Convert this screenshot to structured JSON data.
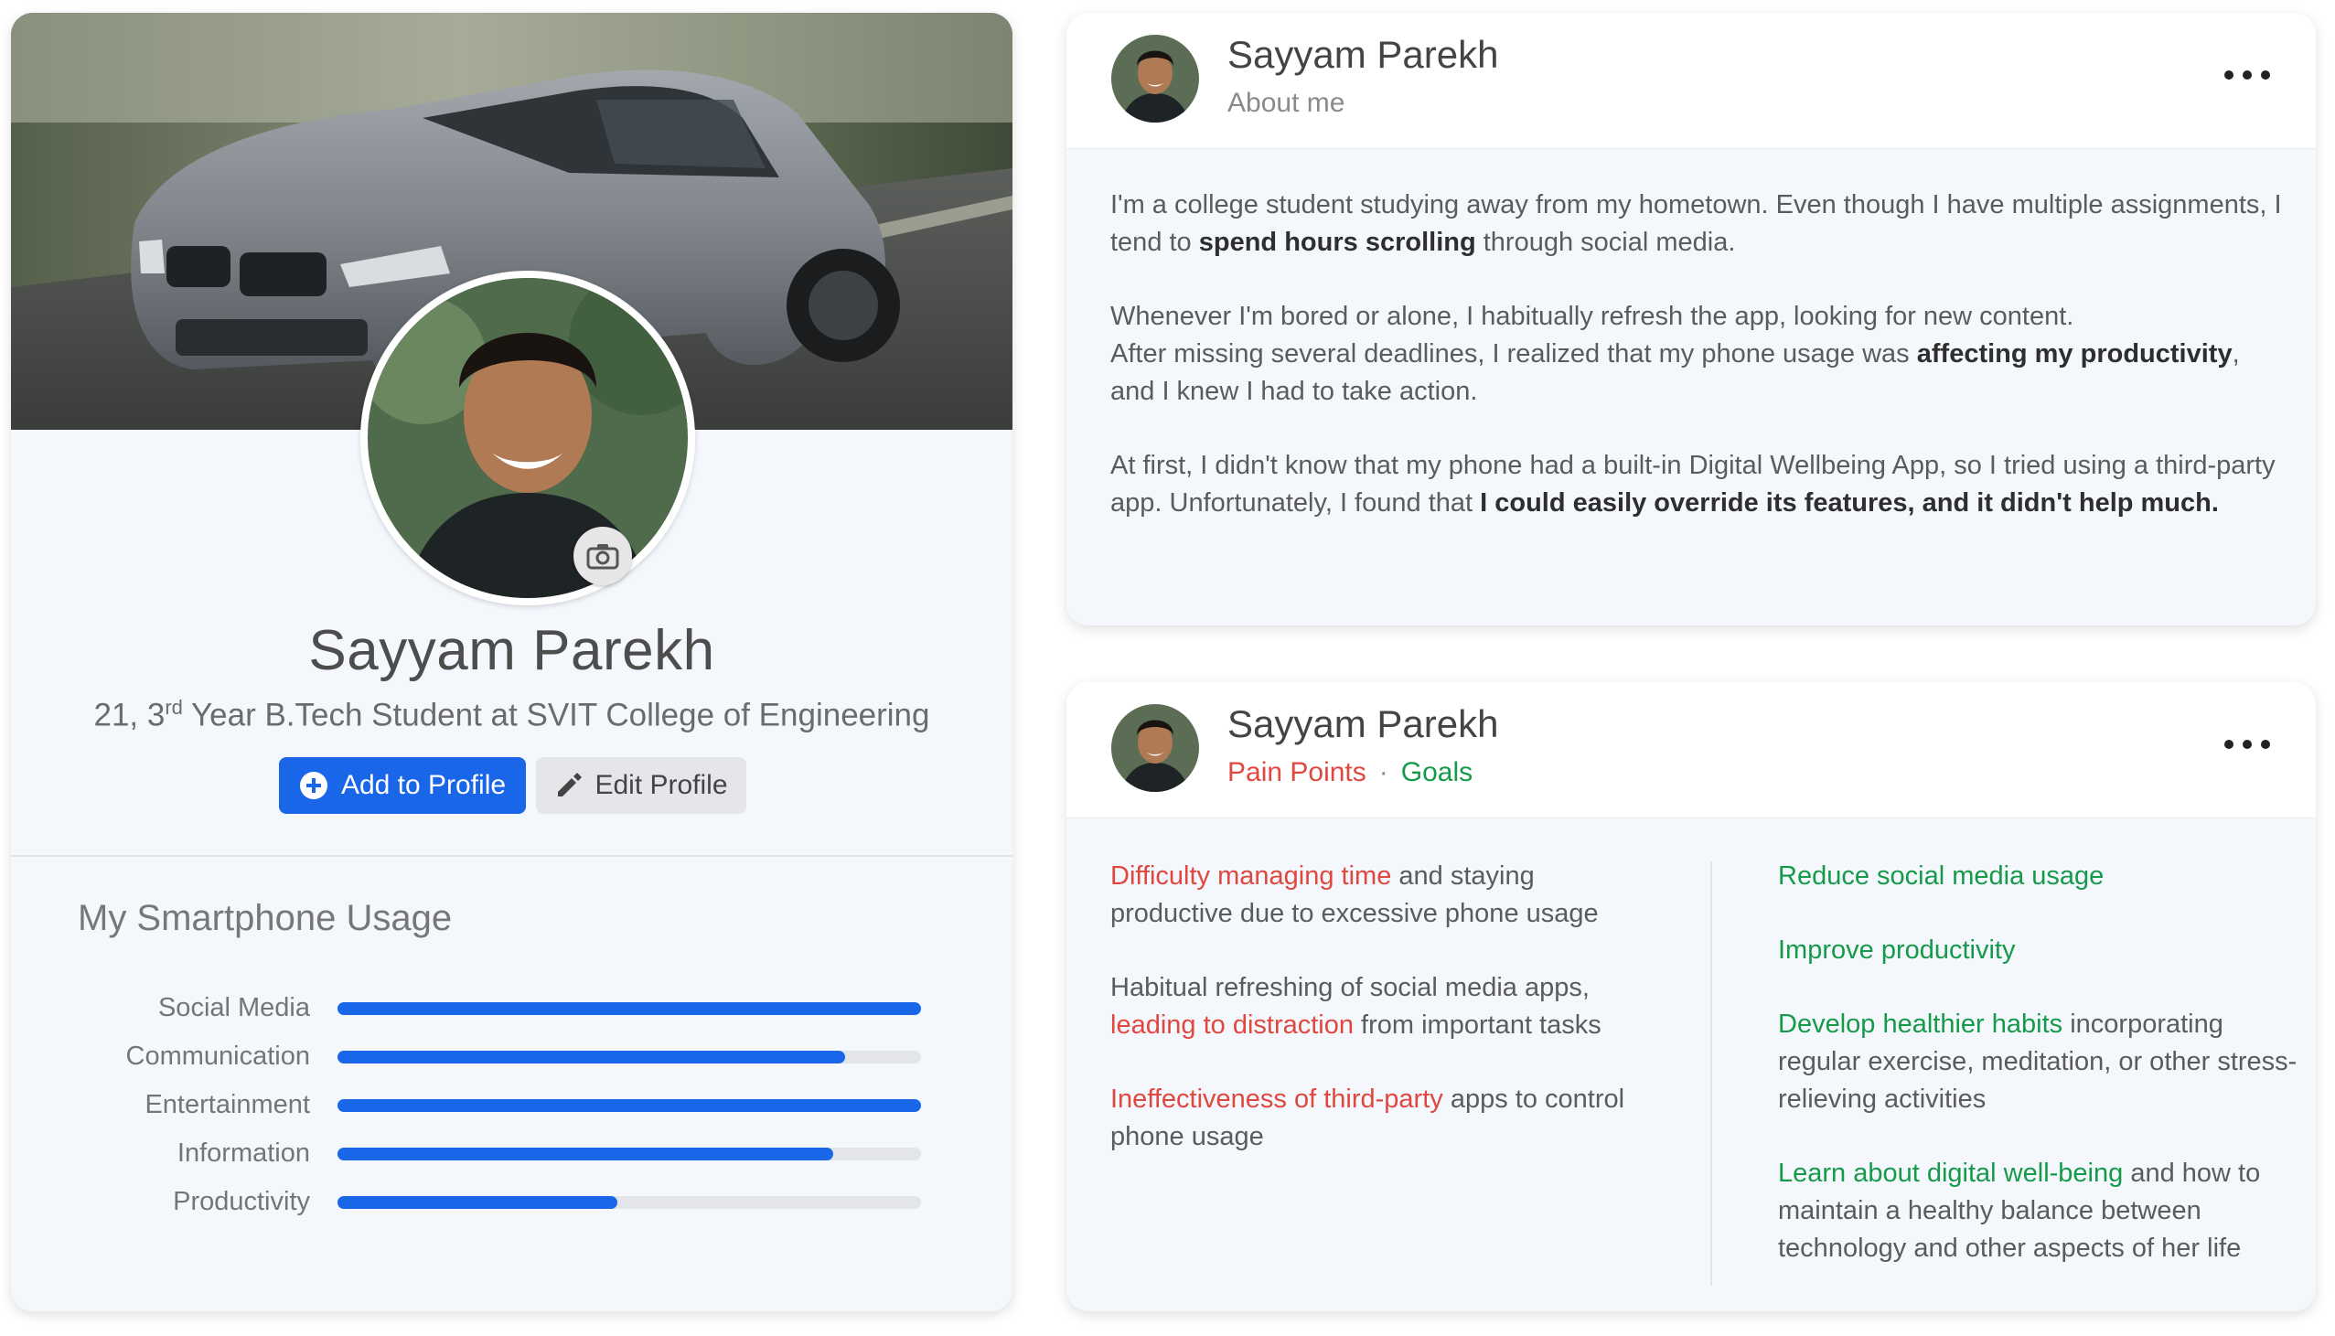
{
  "profile": {
    "name": "Sayyam Parekh",
    "age": "21, 3",
    "ordinal_suffix": "rd",
    "subtitle_rest": " Year B.Tech Student at SVIT College of Engineering",
    "add_button_label": "Add to Profile",
    "edit_button_label": "Edit Profile",
    "cover_image": "grey-sedan-car-photo",
    "camera_icon": "camera-icon"
  },
  "usage": {
    "title": "My Smartphone Usage",
    "accent_color": "#1a66e8",
    "items": [
      {
        "label": "Social Media",
        "value": 1.0
      },
      {
        "label": "Communication",
        "value": 0.87
      },
      {
        "label": "Entertainment",
        "value": 1.0
      },
      {
        "label": "Information",
        "value": 0.85
      },
      {
        "label": "Productivity",
        "value": 0.48
      }
    ]
  },
  "about_card": {
    "name": "Sayyam Parekh",
    "subtitle": "About me",
    "more_icon": "more-horizontal-icon",
    "p1_a": "I'm a college student studying away from my hometown. Even though I have multiple assignments, I tend to ",
    "p1_b": "spend hours scrolling",
    "p1_c": " through social media.",
    "p2_a": "Whenever I'm bored or alone, I habitually refresh the app, looking for new content.",
    "p2_b": "After missing several deadlines, I realized that my phone usage was ",
    "p2_c": "affecting my productivity",
    "p2_d": ", and I knew I had to take action.",
    "p3_a": "At first, I didn't know that my phone had a built-in Digital Wellbeing App, so I tried using a third-party app. Unfortunately, I found that ",
    "p3_b": "I could easily override its features, and it didn't help much."
  },
  "goals_card": {
    "name": "Sayyam Parekh",
    "pain_label": "Pain Points",
    "separator": "·",
    "goals_label": "Goals",
    "pain_color": "#e0473f",
    "goal_color": "#159a4a",
    "pain1_a": "Difficulty managing time",
    "pain1_b": " and staying productive due to excessive phone usage",
    "pain2_a": "Habitual refreshing of social media apps, ",
    "pain2_b": "leading to distraction",
    "pain2_c": " from important tasks",
    "pain3_a": "Ineffectiveness of third-party",
    "pain3_b": " apps to control phone usage",
    "goal1": "Reduce social media usage",
    "goal2": "Improve productivity",
    "goal3_a": "Develop healthier habits",
    "goal3_b": " incorporating regular exercise, meditation, or other stress-relieving activities",
    "goal4_a": "Learn about digital well-being",
    "goal4_b": " and how to maintain a healthy balance between technology and other aspects of her life"
  }
}
